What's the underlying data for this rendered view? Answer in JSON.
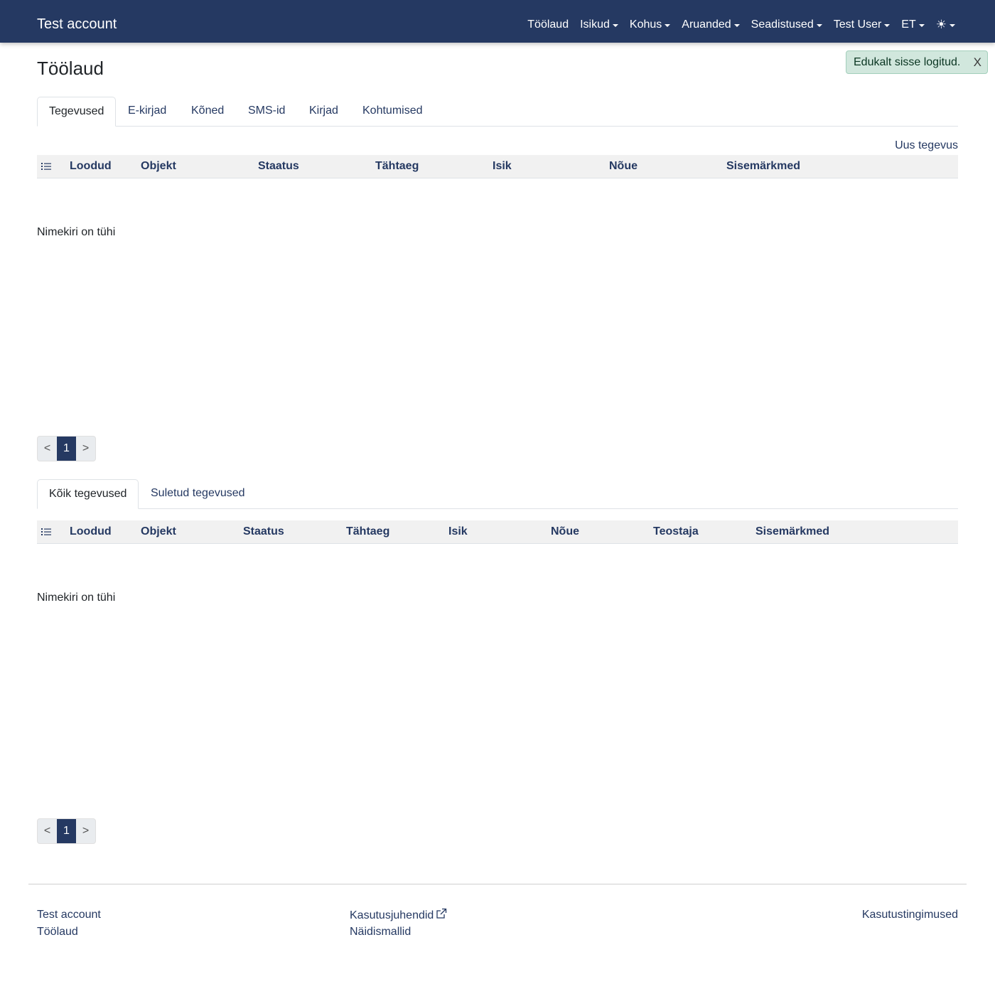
{
  "header": {
    "brand": "Test account",
    "nav": [
      {
        "label": "Töölaud",
        "dropdown": false
      },
      {
        "label": "Isikud",
        "dropdown": true
      },
      {
        "label": "Kohus",
        "dropdown": true
      },
      {
        "label": "Aruanded",
        "dropdown": true
      },
      {
        "label": "Seadistused",
        "dropdown": true
      },
      {
        "label": "Test User",
        "dropdown": true
      },
      {
        "label": "ET",
        "dropdown": true
      }
    ],
    "theme_icon": "☀"
  },
  "alert": {
    "text": "Edukalt sisse logitud.",
    "close": "X"
  },
  "page": {
    "title": "Töölaud"
  },
  "tabs1": [
    "Tegevused",
    "E-kirjad",
    "Kõned",
    "SMS-id",
    "Kirjad",
    "Kohtumised"
  ],
  "section1": {
    "new_action": "Uus tegevus",
    "columns": [
      "Loodud",
      "Objekt",
      "Staatus",
      "Tähtaeg",
      "Isik",
      "Nõue",
      "Sisemärkmed"
    ],
    "empty": "Nimekiri on tühi",
    "pager": {
      "prev": "<",
      "current": "1",
      "next": ">"
    }
  },
  "tabs2": [
    "Kõik tegevused",
    "Suletud tegevused"
  ],
  "section2": {
    "columns": [
      "Loodud",
      "Objekt",
      "Staatus",
      "Tähtaeg",
      "Isik",
      "Nõue",
      "Teostaja",
      "Sisemärkmed"
    ],
    "empty": "Nimekiri on tühi",
    "pager": {
      "prev": "<",
      "current": "1",
      "next": ">"
    }
  },
  "footer": {
    "col1": [
      "Test account",
      "Töölaud"
    ],
    "col2": [
      "Kasutusjuhendid",
      "Näidismallid"
    ],
    "col3": [
      "Kasutustingimused"
    ]
  },
  "colors": {
    "navbar": "#253962",
    "accent": "#253962",
    "alert_bg": "#d1e7dd"
  }
}
